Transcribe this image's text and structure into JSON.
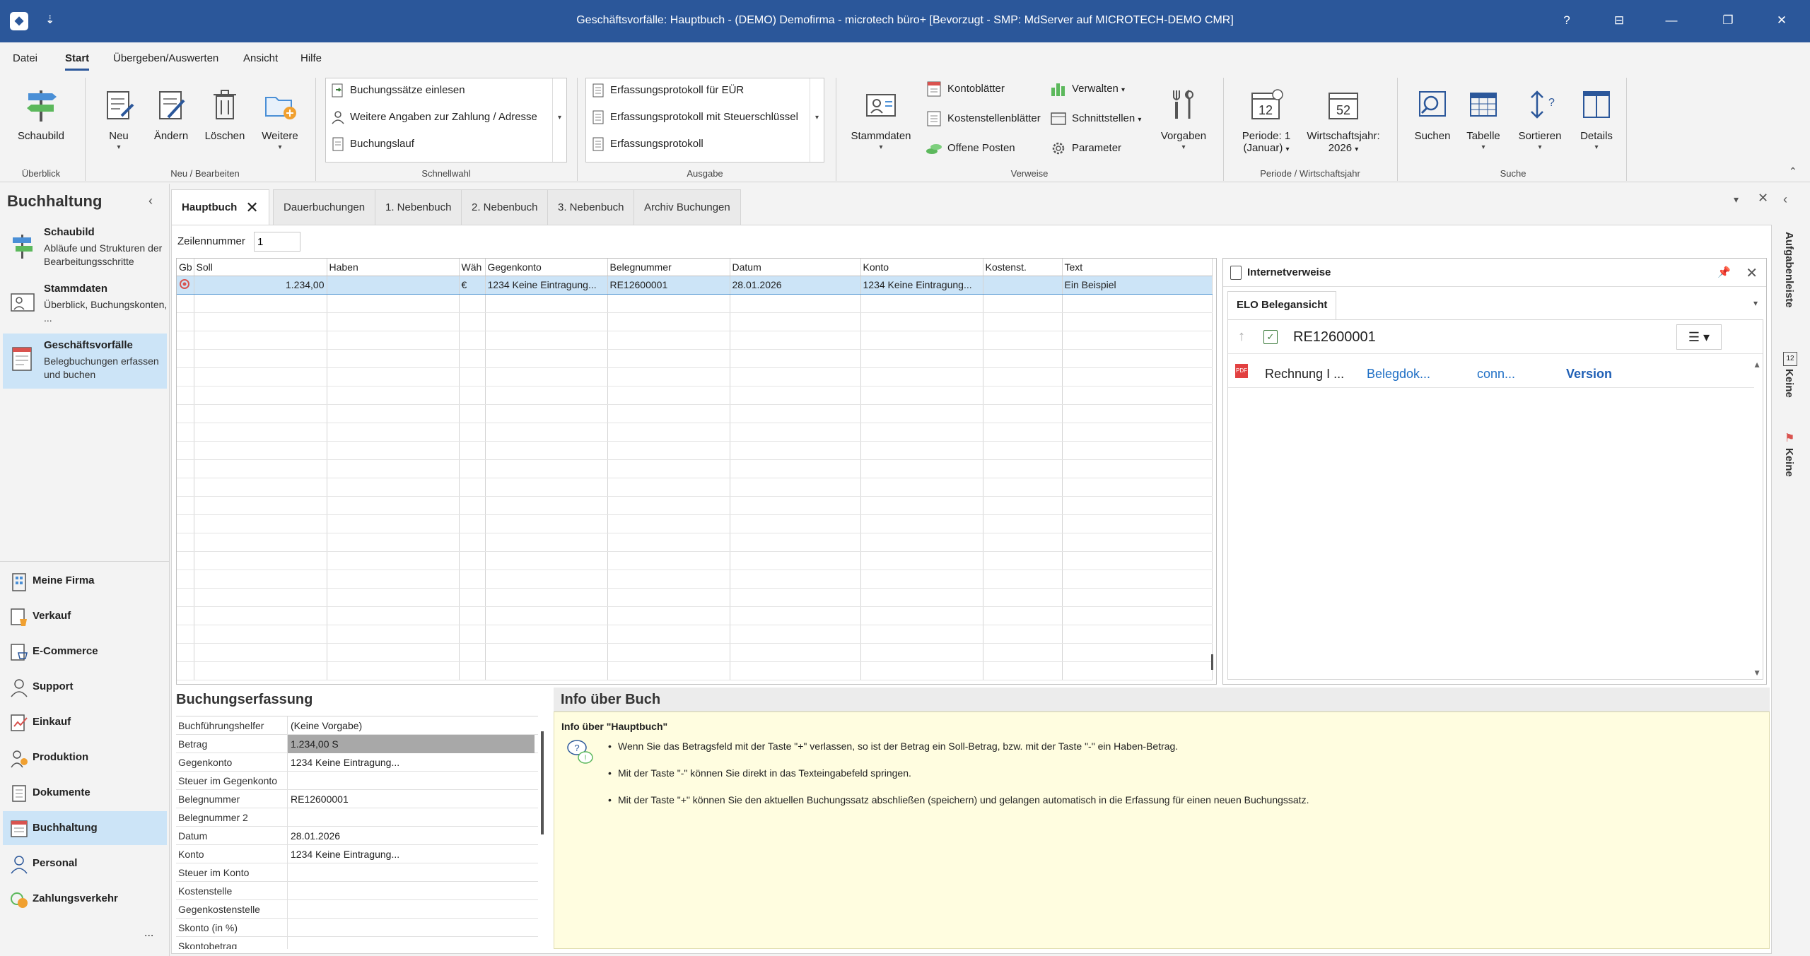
{
  "window": {
    "title": "Geschäftsvorfälle: Hauptbuch - (DEMO) Demofirma - microtech büro+ [Bevorzugt - SMP: MdServer auf MICROTECH-DEMO CMR]",
    "app_icon": "app-logo-icon",
    "quick_access": "⇣",
    "controls": {
      "help": "?",
      "options": "⊟",
      "minimize": "—",
      "restore": "❐",
      "close": "✕"
    }
  },
  "ribbon_tabs": [
    "Datei",
    "Start",
    "Übergeben/Auswerten",
    "Ansicht",
    "Hilfe"
  ],
  "ribbon": {
    "groups": {
      "ueberblick": "Überblick",
      "neu": "Neu / Bearbeiten",
      "schnellwahl": "Schnellwahl",
      "ausgabe": "Ausgabe",
      "verweise": "Verweise",
      "periode": "Periode / Wirtschaftsjahr",
      "suche": "Suche"
    },
    "buttons": {
      "schaubild": "Schaubild",
      "neu": "Neu",
      "aendern": "Ändern",
      "loeschen": "Löschen",
      "weitere": "Weitere",
      "stammdaten": "Stammdaten",
      "vorgaben": "Vorgaben",
      "periode_l1": "Periode: 1",
      "periode_l2": "(Januar)",
      "wj_l1": "Wirtschaftsjahr:",
      "wj_l2": "2026",
      "suchen": "Suchen",
      "tabelle": "Tabelle",
      "sortieren": "Sortieren",
      "details": "Details",
      "periode_icon_num": "12",
      "wj_icon_num": "52"
    },
    "schnellwahl": [
      "Buchungssätze einlesen",
      "Weitere Angaben zur Zahlung / Adresse",
      "Buchungslauf"
    ],
    "ausgabe": [
      "Erfassungsprotokoll für EÜR",
      "Erfassungsprotokoll mit Steuerschlüssel",
      "Erfassungsprotokoll"
    ],
    "verweise": {
      "kontoblaetter": "Kontoblätter",
      "kostenstellenblaetter": "Kostenstellenblätter",
      "offene_posten": "Offene Posten",
      "verwalten": "Verwalten",
      "schnittstellen": "Schnittstellen",
      "parameter": "Parameter"
    }
  },
  "leftnav": {
    "header": "Buchhaltung",
    "big_items": [
      {
        "title": "Schaubild",
        "desc": "Abläufe und Strukturen der Bearbeitungsschritte"
      },
      {
        "title": "Stammdaten",
        "desc": "Überblick, Buchungskonten, ..."
      },
      {
        "title": "Geschäftsvorfälle",
        "desc": "Belegbuchungen erfassen und buchen"
      }
    ],
    "modules": [
      "Meine Firma",
      "Verkauf",
      "E-Commerce",
      "Support",
      "Einkauf",
      "Produktion",
      "Dokumente",
      "Buchhaltung",
      "Personal",
      "Zahlungsverkehr"
    ],
    "more": "..."
  },
  "doc_tabs": [
    "Hauptbuch",
    "Dauerbuchungen",
    "1. Nebenbuch",
    "2. Nebenbuch",
    "3. Nebenbuch",
    "Archiv Buchungen"
  ],
  "zeilennummer": {
    "label": "Zeilennummer",
    "value": "1"
  },
  "grid": {
    "columns": [
      "Gb",
      "Soll",
      "Haben",
      "Wäh",
      "Gegenkonto",
      "Belegnummer",
      "Datum",
      "Konto",
      "Kostenst.",
      "Text"
    ],
    "rows": [
      [
        "",
        "1.234,00",
        "",
        "€",
        "1234 Keine Eintragung...",
        "RE12600001",
        "28.01.2026",
        "1234 Keine Eintragung...",
        "",
        "Ein Beispiel"
      ]
    ]
  },
  "internetverweise": {
    "title": "Internetverweise",
    "tab": "ELO Belegansicht",
    "doc_number": "RE12600001",
    "row": [
      "Rechnung I ...",
      "Belegdok...",
      "conn...",
      "Version"
    ],
    "menu": "☰ ▾"
  },
  "buchungserfassung": {
    "title": "Buchungserfassung",
    "fields": [
      {
        "label": "Buchführungshelfer",
        "value": "(Keine Vorgabe)"
      },
      {
        "label": "Betrag",
        "value": "1.234,00 S"
      },
      {
        "label": "Gegenkonto",
        "value": "1234 Keine Eintragung..."
      },
      {
        "label": "Steuer im Gegenkonto",
        "value": ""
      },
      {
        "label": "Belegnummer",
        "value": "RE12600001"
      },
      {
        "label": "Belegnummer 2",
        "value": ""
      },
      {
        "label": "Datum",
        "value": "28.01.2026"
      },
      {
        "label": "Konto",
        "value": "1234 Keine Eintragung..."
      },
      {
        "label": "Steuer im Konto",
        "value": ""
      },
      {
        "label": "Kostenstelle",
        "value": ""
      },
      {
        "label": "Gegenkostenstelle",
        "value": ""
      },
      {
        "label": "Skonto (in %)",
        "value": ""
      },
      {
        "label": "Skontobetrag",
        "value": ""
      }
    ]
  },
  "info": {
    "title": "Info über Buch",
    "heading": "Info über \"Hauptbuch\"",
    "bullets": [
      "Wenn Sie das Betragsfeld mit der Taste \"+\" verlassen, so ist der Betrag ein Soll-Betrag, bzw. mit der Taste \"-\" ein Haben-Betrag.",
      "Mit der Taste \"-\" können Sie direkt in das Texteingabefeld springen.",
      "Mit der Taste \"+\" können Sie den aktuellen Buchungssatz abschließen (speichern) und gelangen automatisch in die Erfassung für einen neuen Buchungssatz."
    ]
  },
  "right_strip": {
    "aufgabenleiste": "Aufgabenleiste",
    "keine1": "Keine",
    "keine2": "Keine",
    "cal_num": "12"
  },
  "colors": {
    "titlebar": "#2b579a",
    "selection": "#cce4f7",
    "info_bg": "#fffde0"
  }
}
